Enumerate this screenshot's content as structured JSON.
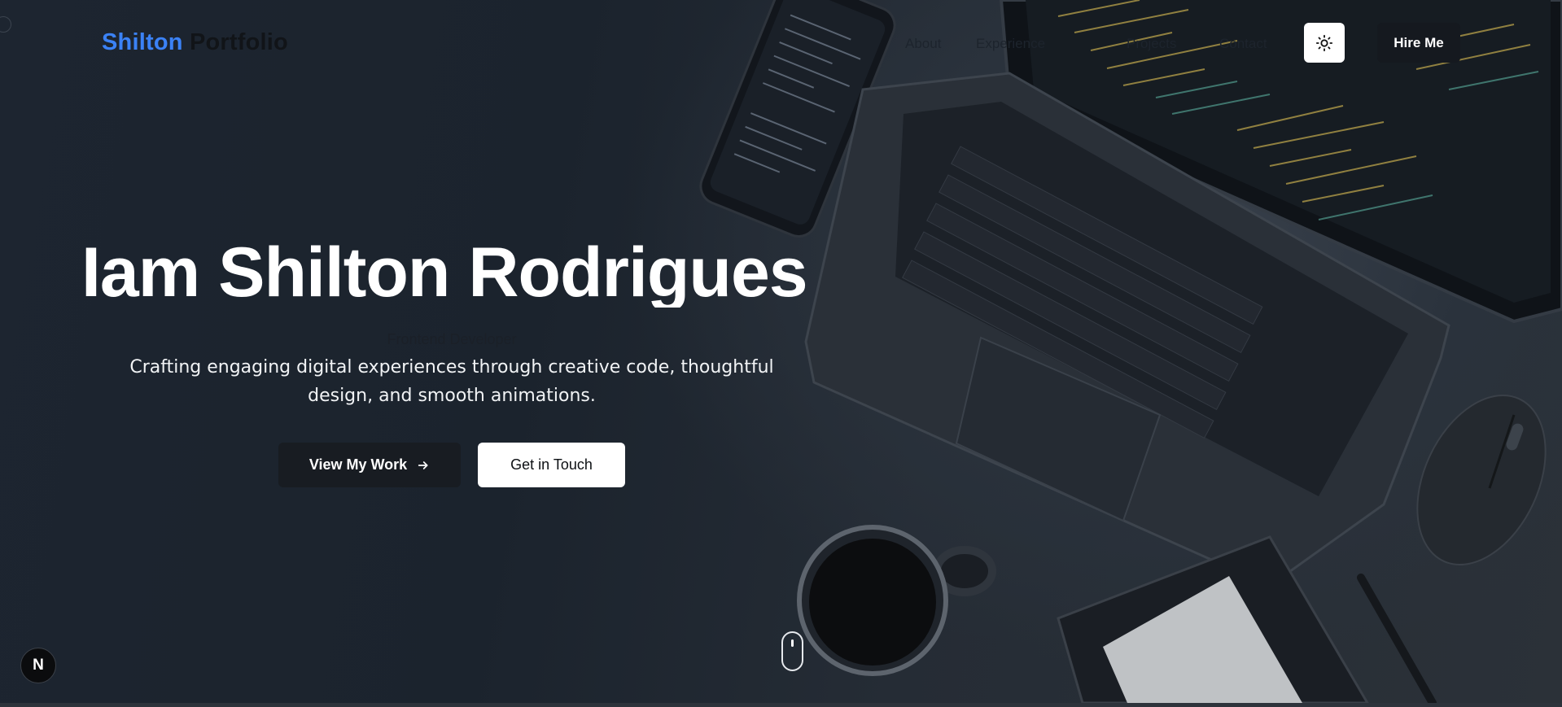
{
  "nav": {
    "brand_first": "Shilton",
    "brand_second": "Portfolio",
    "links": [
      "About",
      "Experience",
      "Projects",
      "Contact"
    ],
    "theme_icon": "sun-icon",
    "hire_label": "Hire Me"
  },
  "hero": {
    "title": "Iam Shilton Rodrigues",
    "role": "Frontend Developer",
    "tagline_line1": "Crafting engaging digital experiences through creative code, thoughtful",
    "tagline_line2": "design, and smooth animations.",
    "primary_label": "View My Work",
    "primary_icon": "arrow-right-icon",
    "secondary_label": "Get in Touch"
  },
  "badge": {
    "letter": "N",
    "icon": "nextjs-icon"
  },
  "colors": {
    "brand_accent": "#3b82f6",
    "background": "#1d2530",
    "button_dark": "#181c22",
    "button_light": "#ffffff"
  }
}
